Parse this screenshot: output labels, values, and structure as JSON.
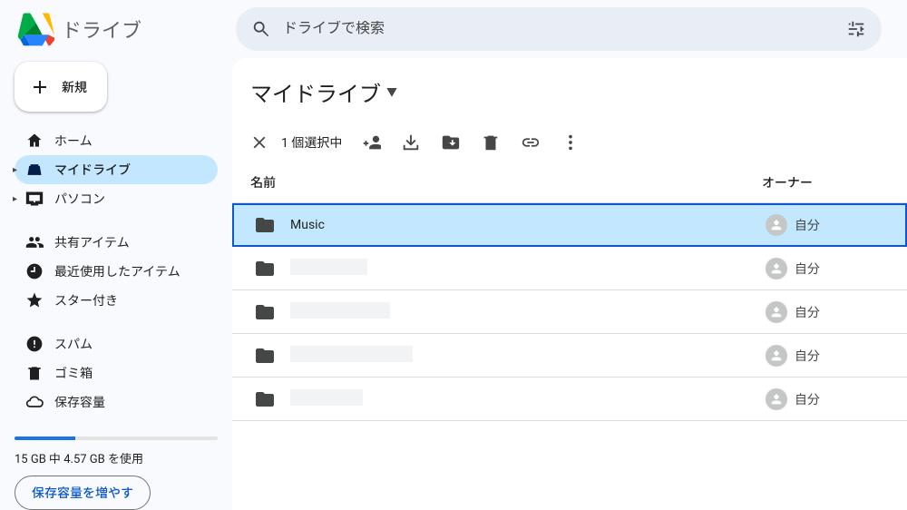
{
  "brand": {
    "name": "ドライブ"
  },
  "search": {
    "placeholder": "ドライブで検索"
  },
  "sidebar": {
    "new_label": "新規",
    "items": [
      {
        "label": "ホーム",
        "icon": "home",
        "active": false,
        "expandable": false
      },
      {
        "label": "マイドライブ",
        "icon": "mydrive",
        "active": true,
        "expandable": true
      },
      {
        "label": "パソコン",
        "icon": "devices",
        "active": false,
        "expandable": true
      }
    ],
    "items2": [
      {
        "label": "共有アイテム",
        "icon": "people"
      },
      {
        "label": "最近使用したアイテム",
        "icon": "clock"
      },
      {
        "label": "スター付き",
        "icon": "star"
      }
    ],
    "items3": [
      {
        "label": "スパム",
        "icon": "spam"
      },
      {
        "label": "ゴミ箱",
        "icon": "trash"
      },
      {
        "label": "保存容量",
        "icon": "cloud"
      }
    ],
    "storage_text": "15 GB 中 4.57 GB を使用",
    "storage_percent": 30,
    "more_storage": "保存容量を増やす"
  },
  "main": {
    "title": "マイドライブ",
    "selection_count": "1 個選択中",
    "columns": {
      "name": "名前",
      "owner": "オーナー"
    },
    "owner_self": "自分",
    "rows": [
      {
        "name": "Music",
        "owner": "自分",
        "selected": true,
        "redacted": false
      },
      {
        "name": "",
        "owner": "自分",
        "selected": false,
        "redacted": true
      },
      {
        "name": "",
        "owner": "自分",
        "selected": false,
        "redacted": true
      },
      {
        "name": "",
        "owner": "自分",
        "selected": false,
        "redacted": true
      },
      {
        "name": "",
        "owner": "自分",
        "selected": false,
        "redacted": true
      }
    ]
  }
}
